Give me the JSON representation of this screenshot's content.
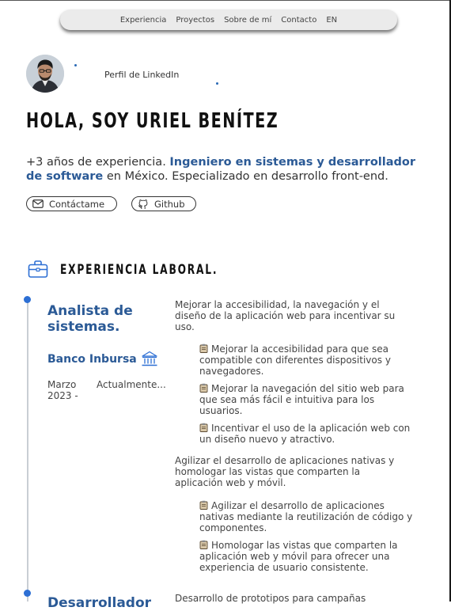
{
  "nav": {
    "links": [
      "Experiencia",
      "Proyectos",
      "Sobre de mí",
      "Contacto",
      "EN"
    ]
  },
  "profile": {
    "linkedin_label": "Perfil de LinkedIn"
  },
  "hero": {
    "title": "HOLA, SOY URIEL BENÍTEZ",
    "intro_lead": "+3 años de experiencia. ",
    "intro_highlight": "Ingeniero en sistemas y desarrollador de software",
    "intro_tail": " en México. Especializado en desarrollo front-end.",
    "contact_label": "Contáctame",
    "github_label": "Github"
  },
  "experience": {
    "section_title": "EXPERIENCIA LABORAL.",
    "jobs": [
      {
        "title": "Analista de sistemas.",
        "company": "Banco Inbursa",
        "date_start": "Marzo 2023 -",
        "date_end": "Actualmente...",
        "groups": [
          {
            "summary": "Mejorar la accesibilidad, la navegación y el diseño de la aplicación web para incentivar su uso.",
            "bullets": [
              "Mejorar la accesibilidad para que sea compatible con diferentes dispositivos y navegadores.",
              "Mejorar la navegación del sitio web para que sea más fácil e intuitiva para los usuarios.",
              "Incentivar el uso de la aplicación web con un diseño nuevo y atractivo."
            ]
          },
          {
            "summary": "Agilizar el desarrollo de aplicaciones nativas y homologar las vistas que comparten la aplicación web y móvil.",
            "bullets": [
              "Agilizar el desarrollo de aplicaciones nativas mediante la reutilización de código y componentes.",
              "Homologar las vistas que comparten la aplicación web y móvil para ofrecer una experiencia de usuario consistente."
            ]
          }
        ]
      },
      {
        "title": "Desarrollador",
        "summary": "Desarrollo de prototipos para campañas"
      }
    ]
  },
  "colors": {
    "accent": "#2b5a96",
    "timeline_dot": "#2d6fd4",
    "navbar_bg": "#ebebeb"
  }
}
